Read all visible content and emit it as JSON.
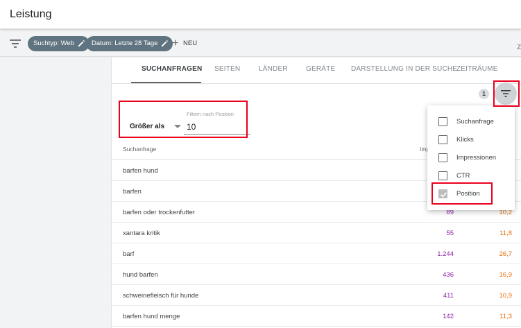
{
  "header": {
    "title": "Leistung"
  },
  "filterbar": {
    "chips": [
      {
        "label": "Suchtyp: Web"
      },
      {
        "label": "Datum: Letzte 28 Tage"
      }
    ],
    "new_label": "NEU",
    "edge_text": "Z"
  },
  "tabs": [
    {
      "label": "SUCHANFRAGEN",
      "active": true
    },
    {
      "label": "SEITEN"
    },
    {
      "label": "LÄNDER"
    },
    {
      "label": "GERÄTE"
    },
    {
      "label": "DARSTELLUNG IN DER SUCHE"
    },
    {
      "label": "ZEITRÄUME"
    }
  ],
  "filter": {
    "badge_count": "1",
    "operator": "Größer als",
    "caption": "Filtern nach Position",
    "value": "10"
  },
  "table": {
    "headers": {
      "query": "Suchanfrage",
      "impressions": "Imp"
    },
    "rows": [
      {
        "query": "barfen hund",
        "impressions": "",
        "position": ""
      },
      {
        "query": "barfen",
        "impressions": "",
        "position": ""
      },
      {
        "query": "barfen oder trockenfutter",
        "impressions": "89",
        "position": "10,2"
      },
      {
        "query": "xantara kritik",
        "impressions": "55",
        "position": "11,8"
      },
      {
        "query": "barf",
        "impressions": "1.244",
        "position": "26,7"
      },
      {
        "query": "hund barfen",
        "impressions": "436",
        "position": "16,9"
      },
      {
        "query": "schweinefleisch für hunde",
        "impressions": "411",
        "position": "10,9"
      },
      {
        "query": "barfen hund menge",
        "impressions": "142",
        "position": "11,3"
      }
    ]
  },
  "dropdown": {
    "items": [
      {
        "label": "Suchanfrage",
        "checked": false
      },
      {
        "label": "Klicks",
        "checked": false
      },
      {
        "label": "Impressionen",
        "checked": false
      },
      {
        "label": "CTR",
        "checked": false
      },
      {
        "label": "Position",
        "checked": true
      }
    ]
  },
  "colors": {
    "impressions": "#8e24aa",
    "position": "#e8710a",
    "highlight": "#e8001c",
    "chip": "#5f7480"
  }
}
